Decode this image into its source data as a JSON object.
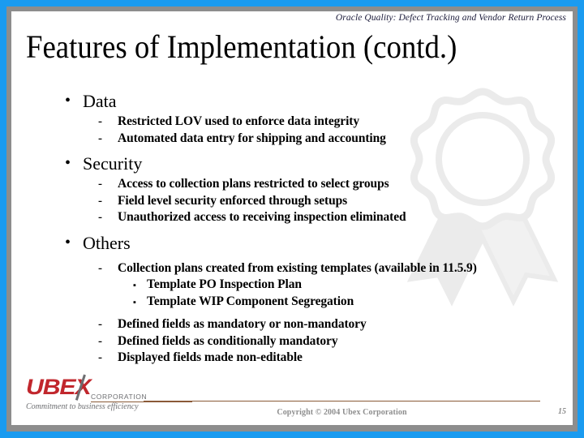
{
  "slide": {
    "header_text": "Oracle Quality: Defect Tracking and Vendor Return Process",
    "title": "Features of Implementation (contd.)",
    "page_number": "15",
    "colors": {
      "outer_border": "#1a9bf0",
      "inner_border": "#8d8d8d",
      "canvas": "#ffffff",
      "header_text": "#1b1b3a",
      "body_text": "#000000",
      "logo_red": "#c1272d",
      "logo_gray": "#6d6e71",
      "rule_brown": "#8a5a37",
      "footer_gray": "#8d8d8d",
      "watermark": "#ebebeb"
    }
  },
  "content": [
    {
      "level": 1,
      "marker": "•",
      "text": "Data",
      "gap": false
    },
    {
      "level": 2,
      "marker": "-",
      "text": "Restricted LOV used to enforce data integrity",
      "gap": false
    },
    {
      "level": 2,
      "marker": "-",
      "text": "Automated data entry for shipping and accounting",
      "gap": false
    },
    {
      "level": 1,
      "marker": "•",
      "text": "Security",
      "gap": true
    },
    {
      "level": 2,
      "marker": "-",
      "text": "Access to collection plans restricted to select groups",
      "gap": false
    },
    {
      "level": 2,
      "marker": "-",
      "text": "Field level security enforced through setups",
      "gap": false
    },
    {
      "level": 2,
      "marker": "-",
      "text": "Unauthorized access to receiving inspection eliminated",
      "gap": false
    },
    {
      "level": 1,
      "marker": "•",
      "text": "Others",
      "gap": true
    },
    {
      "level": 2,
      "marker": "-",
      "text": "Collection plans created from existing templates (available in 11.5.9)",
      "gap": true
    },
    {
      "level": 3,
      "marker": "▪",
      "text": "Template PO Inspection Plan",
      "gap": false
    },
    {
      "level": 3,
      "marker": "▪",
      "text": "Template WIP Component Segregation",
      "gap": false
    },
    {
      "level": 2,
      "marker": "-",
      "text": "Defined fields as mandatory or non-mandatory",
      "gap": true
    },
    {
      "level": 2,
      "marker": "-",
      "text": "Defined fields as conditionally mandatory",
      "gap": false
    },
    {
      "level": 2,
      "marker": "-",
      "text": "Displayed fields made non-editable",
      "gap": false
    }
  ],
  "footer": {
    "logo_word": "UBEX",
    "logo_corporation": "CORPORATION",
    "logo_tagline": "Commitment to business efficiency",
    "copyright": "Copyright © 2004 Ubex Corporation"
  },
  "watermark": {
    "name": "award-ribbon-watermark"
  }
}
